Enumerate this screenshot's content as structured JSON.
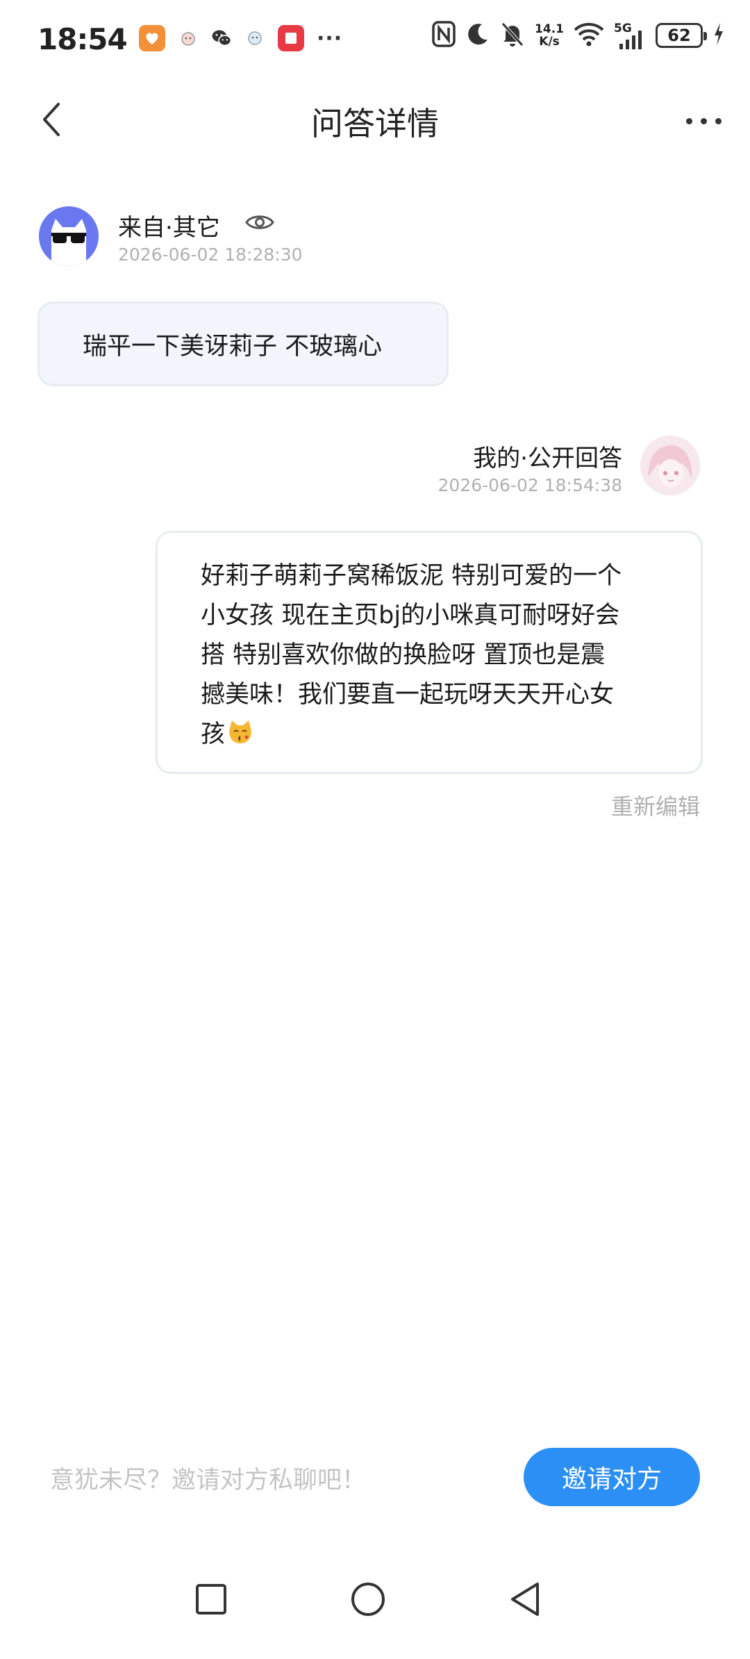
{
  "status_bar": {
    "time": "18:54",
    "network_speed_value": "14.1",
    "network_speed_unit": "K/s",
    "signal_label": "5G",
    "battery_level": "62",
    "overflow_dots": "···"
  },
  "header": {
    "title": "问答详情"
  },
  "question": {
    "source_label": "来自·其它",
    "timestamp": "2026-06-02 18:28:30",
    "text": "瑞平一下美讶莉子 不玻璃心"
  },
  "answer": {
    "label": "我的·公开回答",
    "timestamp": "2026-06-02 18:54:38",
    "lines": [
      "好莉子萌莉子窝稀饭泥 特别可爱的一个",
      "小女孩 现在主页bj的小咪真可耐呀好会",
      "搭 特别喜欢你做的换脸呀 置顶也是震",
      "撼美味！我们要直一起玩呀天天开心女",
      "孩"
    ],
    "edit_label": "重新编辑"
  },
  "invite": {
    "hint": "意犹未尽？邀请对方私聊吧！",
    "button_label": "邀请对方"
  },
  "colors": {
    "accent": "#2b8ff5",
    "question_bubble": "#f2f6fc",
    "muted_text": "#b0b0b0",
    "asker_avatar_bg": "#6a78f0"
  }
}
